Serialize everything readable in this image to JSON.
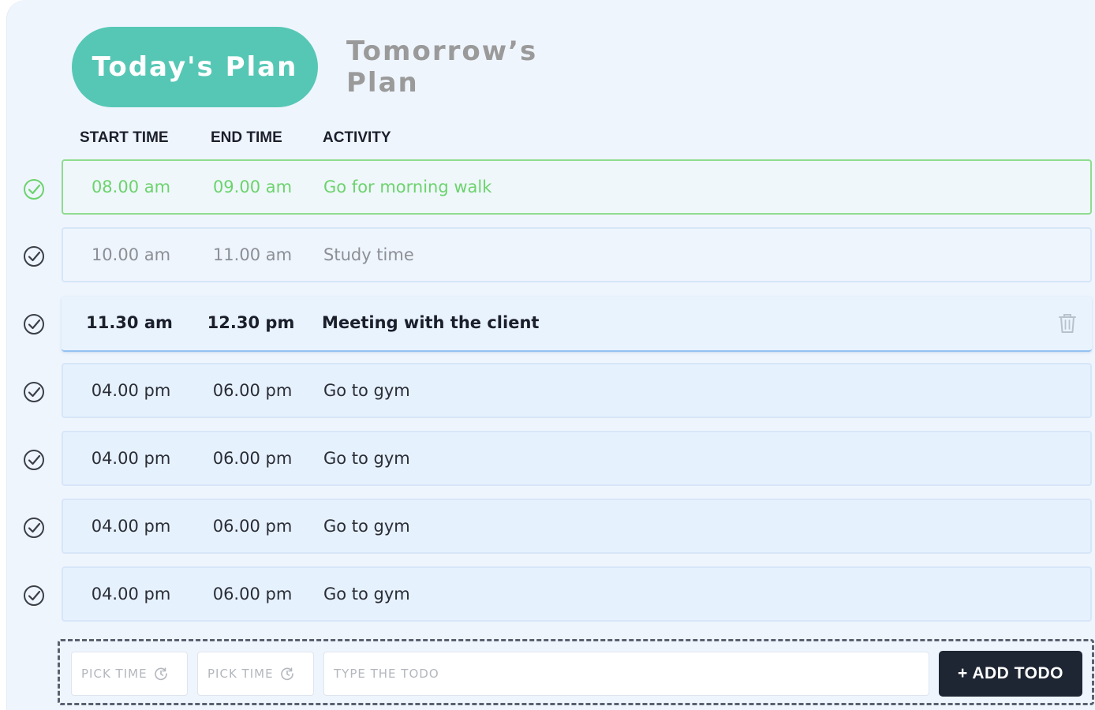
{
  "tabs": {
    "today": "Today's Plan",
    "tomorrow": "Tomorrow’s Plan"
  },
  "columns": {
    "start": "START TIME",
    "end": "END TIME",
    "activity": "ACTIVITY"
  },
  "rows": [
    {
      "start": "08.00 am",
      "end": "09.00 am",
      "activity": "Go for morning walk",
      "state": "done"
    },
    {
      "start": "10.00 am",
      "end": "11.00 am",
      "activity": "Study time",
      "state": "dim"
    },
    {
      "start": "11.30 am",
      "end": "12.30 pm",
      "activity": "Meeting with the client",
      "state": "active"
    },
    {
      "start": "04.00 pm",
      "end": "06.00 pm",
      "activity": "Go to gym",
      "state": "normal"
    },
    {
      "start": "04.00 pm",
      "end": "06.00 pm",
      "activity": "Go to gym",
      "state": "normal"
    },
    {
      "start": "04.00 pm",
      "end": "06.00 pm",
      "activity": "Go to gym",
      "state": "normal"
    },
    {
      "start": "04.00 pm",
      "end": "06.00 pm",
      "activity": "Go to gym",
      "state": "normal"
    }
  ],
  "add_form": {
    "pick_time_1": "PICK TIME",
    "pick_time_2": "PICK TIME",
    "todo_placeholder": "TYPE THE TODO",
    "add_button": "+ ADD TODO"
  },
  "colors": {
    "accent": "#56c7b5",
    "done": "#6cd36c",
    "button": "#1f2633"
  },
  "icons": {
    "check": "check-circle-icon",
    "delete": "trash-icon",
    "clock": "clock-icon"
  }
}
